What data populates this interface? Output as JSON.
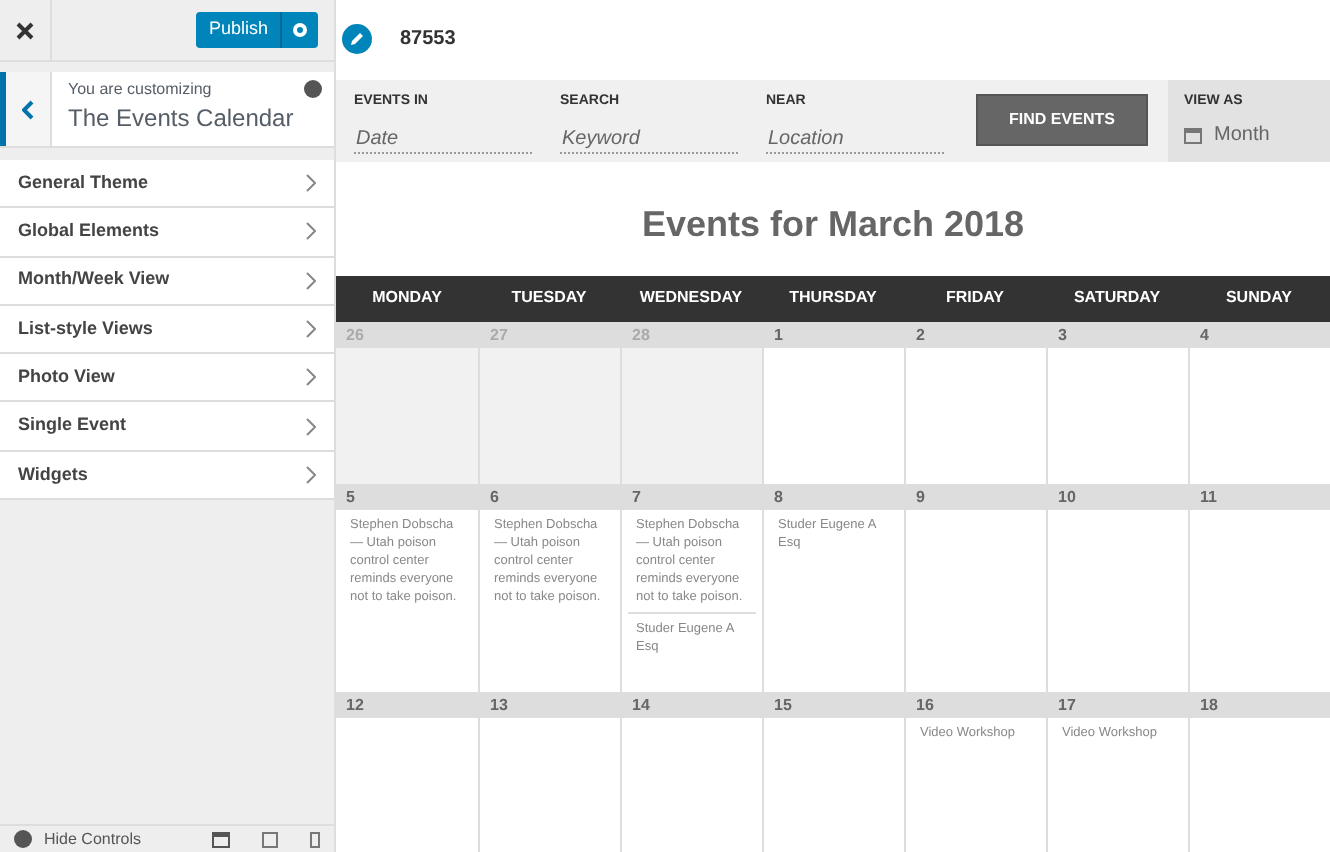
{
  "sidebar": {
    "publish_button": "Publish",
    "customizing_label": "You are customizing",
    "customizing_title": "The Events Calendar",
    "items": [
      {
        "label": "General Theme"
      },
      {
        "label": "Global Elements"
      },
      {
        "label": "Month/Week View"
      },
      {
        "label": "List-style Views"
      },
      {
        "label": "Photo View"
      },
      {
        "label": "Single Event"
      },
      {
        "label": "Widgets"
      }
    ],
    "footer": {
      "hide_controls": "Hide Controls"
    }
  },
  "site": {
    "title": "87553"
  },
  "filter_bar": {
    "fields": [
      {
        "label": "EVENTS IN",
        "placeholder": "Date"
      },
      {
        "label": "SEARCH",
        "placeholder": "Keyword"
      },
      {
        "label": "NEAR",
        "placeholder": "Location"
      }
    ],
    "find_button": "FIND EVENTS",
    "view_as": {
      "label": "VIEW AS",
      "value": "Month"
    }
  },
  "calendar": {
    "title": "Events for March 2018",
    "weekdays": [
      "MONDAY",
      "TUESDAY",
      "WEDNESDAY",
      "THURSDAY",
      "FRIDAY",
      "SATURDAY",
      "SUNDAY"
    ],
    "weeks": [
      [
        {
          "day": "26",
          "other_month": true
        },
        {
          "day": "27",
          "other_month": true
        },
        {
          "day": "28",
          "other_month": true
        },
        {
          "day": "1",
          "other_month": false
        },
        {
          "day": "2",
          "other_month": false
        },
        {
          "day": "3",
          "other_month": false
        },
        {
          "day": "4",
          "other_month": false
        }
      ],
      [
        {
          "day": "5",
          "other_month": false,
          "events": [
            "Stephen Dobscha — Utah poison control center reminds everyone not to take poison."
          ]
        },
        {
          "day": "6",
          "other_month": false,
          "events": [
            "Stephen Dobscha — Utah poison control center reminds everyone not to take poison."
          ]
        },
        {
          "day": "7",
          "other_month": false,
          "events": [
            "Stephen Dobscha — Utah poison control center reminds everyone not to take poison.",
            "Studer Eugene A Esq"
          ]
        },
        {
          "day": "8",
          "other_month": false,
          "events": [
            "Studer Eugene A Esq"
          ]
        },
        {
          "day": "9",
          "other_month": false
        },
        {
          "day": "10",
          "other_month": false
        },
        {
          "day": "11",
          "other_month": false
        }
      ],
      [
        {
          "day": "12",
          "other_month": false
        },
        {
          "day": "13",
          "other_month": false
        },
        {
          "day": "14",
          "other_month": false
        },
        {
          "day": "15",
          "other_month": false
        },
        {
          "day": "16",
          "other_month": false,
          "events": [
            "Video Workshop"
          ]
        },
        {
          "day": "17",
          "other_month": false,
          "events": [
            "Video Workshop"
          ]
        },
        {
          "day": "18",
          "other_month": false
        }
      ]
    ]
  }
}
